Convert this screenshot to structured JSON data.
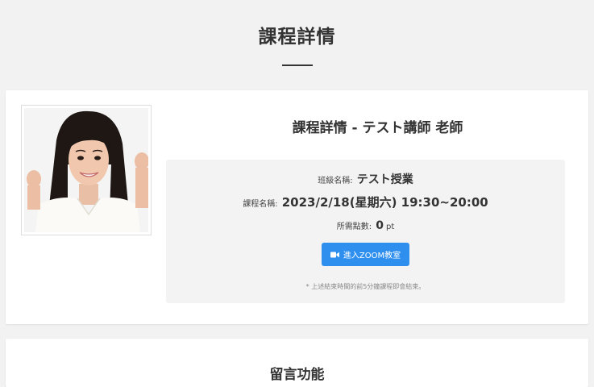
{
  "header": {
    "title": "課程詳情"
  },
  "course": {
    "heading": "課程詳情 - テスト講師 老師",
    "class_label": "班級名稱:",
    "class_value": "テスト授業",
    "course_label": "課程名稱:",
    "course_value": "2023/2/18(星期六) 19:30~20:00",
    "points_label": "所需點數:",
    "points_value": "0",
    "points_unit": "pt",
    "zoom_button_label": "進入ZOOM教室",
    "zoom_button_icon": "video-camera-icon",
    "note": "* 上述結束時間的前5分鐘課程即會結束。"
  },
  "section2": {
    "title": "留言功能"
  },
  "colors": {
    "background": "#f2f2f2",
    "accent": "#2e8fef",
    "info_box": "#f3f3f3"
  }
}
